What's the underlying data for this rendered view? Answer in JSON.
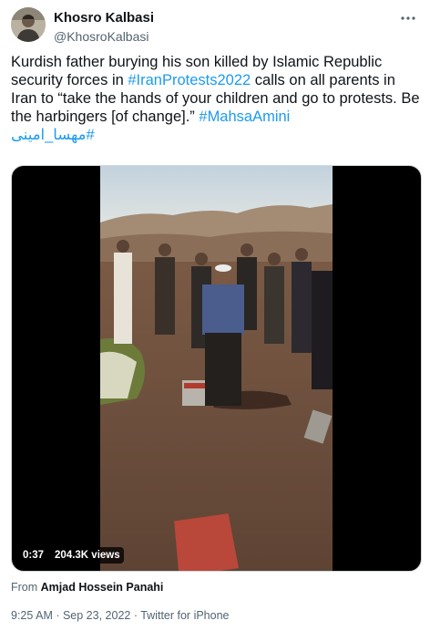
{
  "author": {
    "display_name": "Khosro Kalbasi",
    "handle": "@KhosroKalbasi"
  },
  "icons": {
    "more": "more-dots-icon"
  },
  "tweet": {
    "text_1": "Kurdish father burying his son killed by Islamic Republic security forces in ",
    "hashtag_1": "#IranProtests2022",
    "text_2": " calls on all parents in Iran to “take the hands of your children and go to protests. Be the harbingers [of change].” ",
    "hashtag_2": "#MahsaAmini",
    "hashtag_3": "#مهسا_امینی"
  },
  "media": {
    "duration": "0:37",
    "views": "204.3K views"
  },
  "attribution": {
    "prefix": "From ",
    "source": "Amjad Hossein Panahi"
  },
  "meta": {
    "timestamp": "9:25 AM · Sep 23, 2022 · Twitter for iPhone"
  },
  "colors": {
    "link": "#1d9bf0",
    "text": "#0f1419",
    "muted": "#536471"
  }
}
